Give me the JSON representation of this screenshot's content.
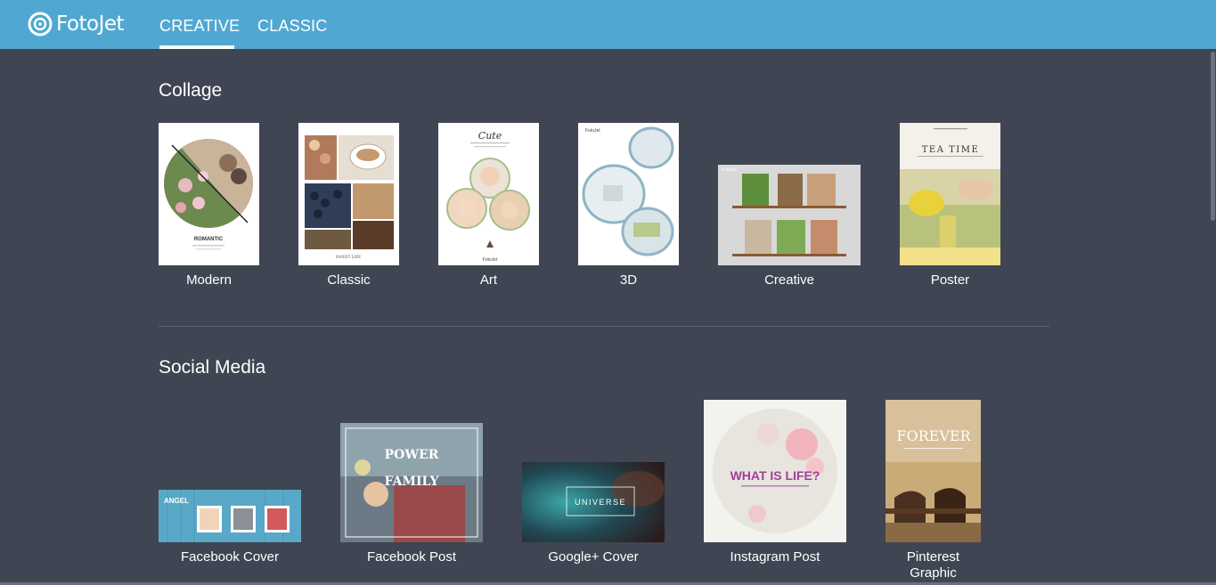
{
  "header": {
    "logo_text": "FotoJet",
    "tabs": [
      {
        "label": "CREATIVE",
        "active": true
      },
      {
        "label": "CLASSIC",
        "active": false
      }
    ],
    "bg_color": "#50a8d2"
  },
  "collage": {
    "title": "Collage",
    "items": [
      {
        "label": "Modern",
        "thumb_text": "ROMANTIC"
      },
      {
        "label": "Classic",
        "thumb_text": "SWEET LIFE"
      },
      {
        "label": "Art",
        "thumb_text": "Cute"
      },
      {
        "label": "3D",
        "thumb_text": "FotoJet"
      },
      {
        "label": "Creative",
        "thumb_text": "FotoJet"
      },
      {
        "label": "Poster",
        "thumb_text": "TEA TIME"
      }
    ]
  },
  "social": {
    "title": "Social Media",
    "items": [
      {
        "label": "Facebook Cover",
        "thumb_text": "ANGEL"
      },
      {
        "label": "Facebook Post",
        "thumb_text": "POWER",
        "thumb_text2": "FAMILY"
      },
      {
        "label": "Google+ Cover",
        "thumb_text": "UNIVERSE"
      },
      {
        "label": "Instagram Post",
        "thumb_text": "WHAT IS LIFE?"
      },
      {
        "label": "Pinterest Graphic",
        "thumb_text": "FOREVER"
      }
    ]
  },
  "colors": {
    "background": "#3f4552",
    "accent": "#50a8d2"
  }
}
